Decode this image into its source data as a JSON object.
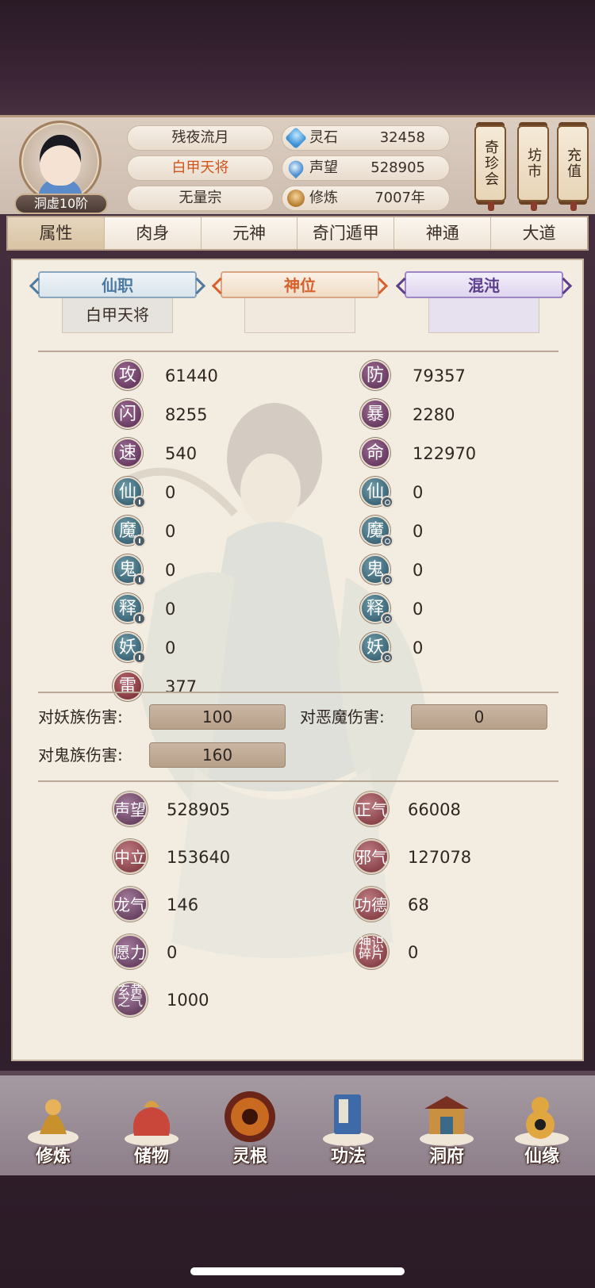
{
  "header": {
    "rank_badge": "洞虚10阶",
    "titles": [
      "残夜流月",
      "白甲天将",
      "无量宗"
    ],
    "resources": [
      {
        "icon": "spirit-stone-icon",
        "label": "灵石",
        "value": "32458"
      },
      {
        "icon": "reputation-drop-icon",
        "label": "声望",
        "value": "528905"
      },
      {
        "icon": "cultivation-meditation-icon",
        "label": "修炼",
        "value": "7007年"
      }
    ],
    "shops": [
      "奇珍会",
      "坊市",
      "充值"
    ]
  },
  "tabs": [
    "属性",
    "肉身",
    "元神",
    "奇门遁甲",
    "神通",
    "大道"
  ],
  "active_tab": "属性",
  "ranks": [
    {
      "label": "仙职",
      "value": "白甲天将"
    },
    {
      "label": "神位",
      "value": ""
    },
    {
      "label": "混沌",
      "value": ""
    }
  ],
  "stats_left": [
    {
      "label": "攻",
      "value": "61440",
      "color": "purple"
    },
    {
      "label": "闪",
      "value": "8255",
      "color": "purple"
    },
    {
      "label": "速",
      "value": "540",
      "color": "purple"
    },
    {
      "label": "仙",
      "value": "0",
      "color": "teal"
    },
    {
      "label": "魔",
      "value": "0",
      "color": "teal"
    },
    {
      "label": "鬼",
      "value": "0",
      "color": "teal"
    },
    {
      "label": "释",
      "value": "0",
      "color": "teal"
    },
    {
      "label": "妖",
      "value": "0",
      "color": "teal"
    },
    {
      "label": "雷",
      "value": "377",
      "color": "red"
    }
  ],
  "stats_right": [
    {
      "label": "防",
      "value": "79357",
      "color": "purple"
    },
    {
      "label": "暴",
      "value": "2280",
      "color": "purple"
    },
    {
      "label": "命",
      "value": "122970",
      "color": "purple"
    },
    {
      "label": "仙",
      "value": "0",
      "color": "teal"
    },
    {
      "label": "魔",
      "value": "0",
      "color": "teal"
    },
    {
      "label": "鬼",
      "value": "0",
      "color": "teal"
    },
    {
      "label": "释",
      "value": "0",
      "color": "teal"
    },
    {
      "label": "妖",
      "value": "0",
      "color": "teal"
    }
  ],
  "damage": [
    {
      "label": "对妖族伤害:",
      "value": "100"
    },
    {
      "label": "对恶魔伤害:",
      "value": "0"
    },
    {
      "label": "对鬼族伤害:",
      "value": "160"
    }
  ],
  "reputation_left": [
    {
      "label": "声望",
      "value": "528905",
      "color": "purple"
    },
    {
      "label": "中立",
      "value": "153640",
      "color": "red"
    },
    {
      "label": "龙气",
      "value": "146",
      "color": "purple"
    },
    {
      "label": "愿力",
      "value": "0",
      "color": "purple"
    },
    {
      "label": "玄黄之气",
      "value": "1000",
      "color": "purple"
    }
  ],
  "reputation_right": [
    {
      "label": "正气",
      "value": "66008",
      "color": "red"
    },
    {
      "label": "邪气",
      "value": "127078",
      "color": "red"
    },
    {
      "label": "功德",
      "value": "68",
      "color": "red"
    },
    {
      "label": "神识碎片",
      "value": "0",
      "color": "red"
    }
  ],
  "bottom_nav": [
    {
      "label": "修炼",
      "icon": "cultivation-figure-icon"
    },
    {
      "label": "储物",
      "icon": "storage-bag-icon"
    },
    {
      "label": "灵根",
      "icon": "spirit-root-icon"
    },
    {
      "label": "功法",
      "icon": "technique-book-icon"
    },
    {
      "label": "洞府",
      "icon": "cave-dwelling-icon"
    },
    {
      "label": "仙缘",
      "icon": "immortal-gourd-icon"
    }
  ],
  "colors": {
    "accent_orange": "#d0541c",
    "stat_purple": "#6a3c63",
    "stat_teal": "#3d6778",
    "stat_red": "#86383f"
  }
}
